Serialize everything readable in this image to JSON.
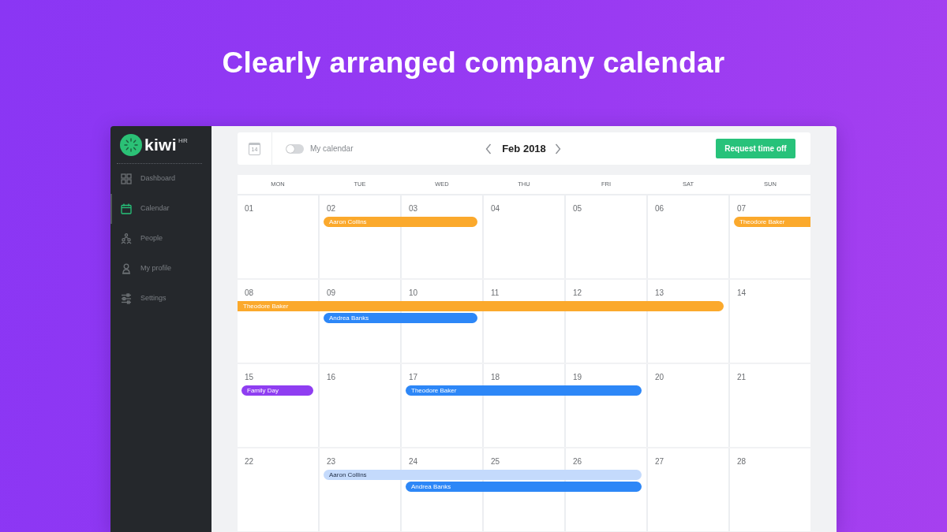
{
  "headline": "Clearly arranged company calendar",
  "sidebar": {
    "logo": "kiwi$^{HR}$",
    "items": [
      {
        "label": "Dashboard",
        "selected": false
      },
      {
        "label": "Calendar",
        "selected": true
      },
      {
        "label": "People",
        "selected": false
      },
      {
        "label": "My profile",
        "selected": false
      },
      {
        "label": "Settings",
        "selected": false
      }
    ]
  },
  "toolbar": {
    "today": "14",
    "my_calendar": {
      "label": "My calendar",
      "on": false
    },
    "month": "Feb 2018",
    "action": "Request time off"
  },
  "calendar": {
    "weekdays": [
      "MON",
      "TUE",
      "WED",
      "THU",
      "FRI",
      "SAT",
      "SUN"
    ],
    "weeks": [
      {
        "days": [
          "01",
          "02",
          "03",
          "04",
          "05",
          "06",
          "07"
        ],
        "events": [
          {
            "label": "Aaron Collins",
            "color": "#fba92c",
            "days": [
              false,
              true,
              true,
              false,
              false,
              false,
              false
            ],
            "continues_before": false,
            "continues_after": false
          },
          {
            "label": "Theodore Baker",
            "color": "#fba92c",
            "days": [
              false,
              false,
              false,
              false,
              false,
              false,
              true
            ],
            "continues_before": false,
            "continues_after": true
          }
        ]
      },
      {
        "days": [
          "08",
          "09",
          "10",
          "11",
          "12",
          "13",
          "14"
        ],
        "events": [
          {
            "label": "Theodore Baker",
            "color": "#fba92c",
            "days": [
              true,
              true,
              true,
              true,
              true,
              true,
              false
            ],
            "continues_before": true,
            "continues_after": false
          },
          {
            "label": "Andrea Banks",
            "color": "#2d87f7",
            "days": [
              false,
              true,
              true,
              false,
              false,
              false,
              false
            ],
            "continues_before": false,
            "continues_after": false
          }
        ]
      },
      {
        "days": [
          "15",
          "16",
          "17",
          "18",
          "19",
          "20",
          "21"
        ],
        "events": [
          {
            "label": "Family Day",
            "color": "#8f3ef1",
            "days": [
              true,
              false,
              false,
              false,
              false,
              false,
              false
            ],
            "continues_before": false,
            "continues_after": false
          },
          {
            "label": "Theodore Baker",
            "color": "#2d87f7",
            "days": [
              false,
              false,
              true,
              true,
              true,
              false,
              false
            ],
            "continues_before": false,
            "continues_after": false
          }
        ]
      },
      {
        "days": [
          "22",
          "23",
          "24",
          "25",
          "26",
          "27",
          "28"
        ],
        "events": [
          {
            "label": "Aaron Collins",
            "color": "#c4dafc",
            "days": [
              false,
              true,
              true,
              true,
              true,
              false,
              false
            ],
            "continues_before": false,
            "continues_after": false
          },
          {
            "label": "Andrea Banks",
            "color": "#2d87f7",
            "days": [
              false,
              false,
              true,
              true,
              true,
              false,
              false
            ],
            "continues_before": false,
            "continues_after": false
          }
        ]
      }
    ]
  }
}
